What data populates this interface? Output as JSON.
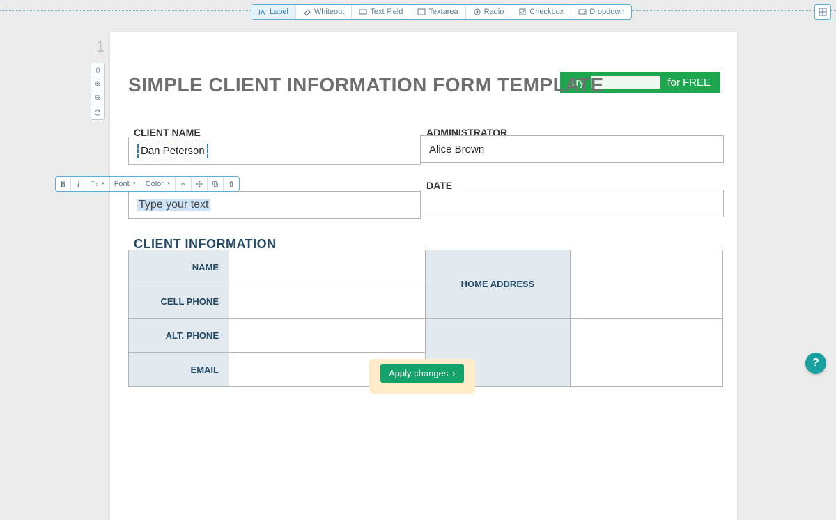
{
  "toolbar": {
    "label": "Label",
    "whiteout": "Whiteout",
    "textfield": "Text Field",
    "textarea": "Textarea",
    "radio": "Radio",
    "checkbox": "Checkbox",
    "dropdown": "Dropdown"
  },
  "page_number": "1",
  "promo": {
    "try": "Try",
    "for_free": "for FREE"
  },
  "title": "SIMPLE CLIENT INFORMATION FORM TEMPLATE",
  "labels": {
    "client_name": "CLIENT NAME",
    "administrator": "ADMINISTRATOR",
    "date": "DATE"
  },
  "fields": {
    "client_name_value": "Dan Peterson",
    "administrator_value": "Alice Brown",
    "placeholder_text": "Type your text"
  },
  "section": {
    "client_info": "CLIENT INFORMATION"
  },
  "info_table": {
    "name": "NAME",
    "cell_phone": "CELL PHONE",
    "alt_phone": "ALT. PHONE",
    "email": "EMAIL",
    "home_address": "HOME ADDRESS"
  },
  "fmt": {
    "bold": "B",
    "italic": "I",
    "size": "T",
    "font": "Font",
    "color": "Color"
  },
  "apply": "Apply changes",
  "help": "?"
}
